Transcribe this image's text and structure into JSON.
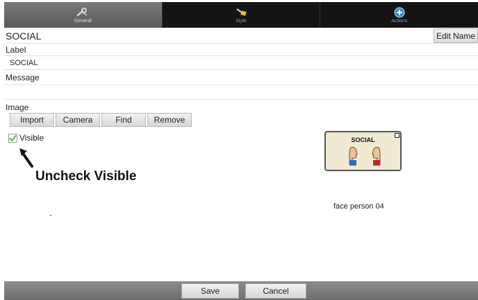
{
  "tabs": [
    {
      "label": "General",
      "icon": "wrench-icon",
      "active": true
    },
    {
      "label": "Style",
      "icon": "paintbrush-icon",
      "active": false
    },
    {
      "label": "Actions",
      "icon": "plus-circle-icon",
      "active": false
    }
  ],
  "header": {
    "title": "SOCIAL",
    "edit_button": "Edit Name"
  },
  "fields": {
    "label_heading": "Label",
    "label_value": "SOCIAL",
    "message_heading": "Message",
    "message_value": "",
    "image_heading": "Image"
  },
  "image_buttons": [
    "Import",
    "Camera",
    "Find",
    "Remove"
  ],
  "visible": {
    "label": "Visible",
    "checked": true
  },
  "annotation": {
    "text": "Uncheck Visible"
  },
  "preview": {
    "tile_text": "SOCIAL",
    "caption": "face person 04"
  },
  "footer": {
    "save": "Save",
    "cancel": "Cancel"
  },
  "colors": {
    "accent_check": "#5cb85c",
    "actions_icon": "#2a8fd6",
    "style_icon": "#e0c030"
  }
}
